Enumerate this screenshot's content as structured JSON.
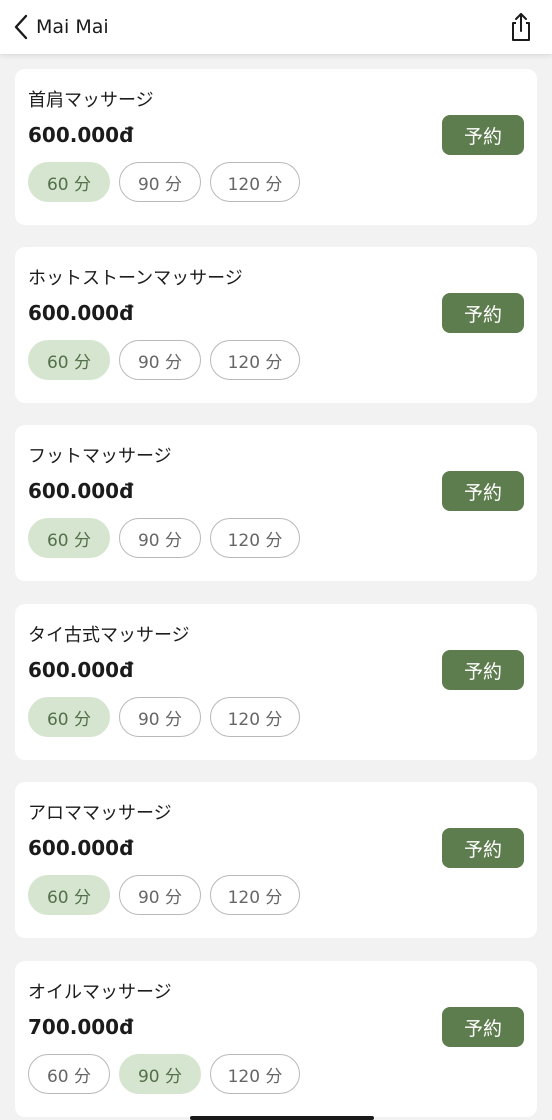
{
  "header": {
    "title": "Mai Mai"
  },
  "services": [
    {
      "name": "首肩マッサージ",
      "price": "600.000đ",
      "book_label": "予約",
      "durations": [
        "60 分",
        "90 分",
        "120 分"
      ],
      "selected_duration": "60 分"
    },
    {
      "name": "ホットストーンマッサージ",
      "price": "600.000đ",
      "book_label": "予約",
      "durations": [
        "60 分",
        "90 分",
        "120 分"
      ],
      "selected_duration": "60 分"
    },
    {
      "name": "フットマッサージ",
      "price": "600.000đ",
      "book_label": "予約",
      "durations": [
        "60 分",
        "90 分",
        "120 分"
      ],
      "selected_duration": "60 分"
    },
    {
      "name": "タイ古式マッサージ",
      "price": "600.000đ",
      "book_label": "予約",
      "durations": [
        "60 分",
        "90 分",
        "120 分"
      ],
      "selected_duration": "60 分"
    },
    {
      "name": "アロママッサージ",
      "price": "600.000đ",
      "book_label": "予約",
      "durations": [
        "60 分",
        "90 分",
        "120 分"
      ],
      "selected_duration": "60 分"
    },
    {
      "name": "オイルマッサージ",
      "price": "700.000đ",
      "book_label": "予約",
      "durations": [
        "60 分",
        "90 分",
        "120 分"
      ],
      "selected_duration": "90 分"
    }
  ],
  "colors": {
    "accent": "#5e7d4e",
    "chip_selected_bg": "#d6e5d0",
    "chip_selected_text": "#53704a",
    "background": "#f2f2f2"
  }
}
